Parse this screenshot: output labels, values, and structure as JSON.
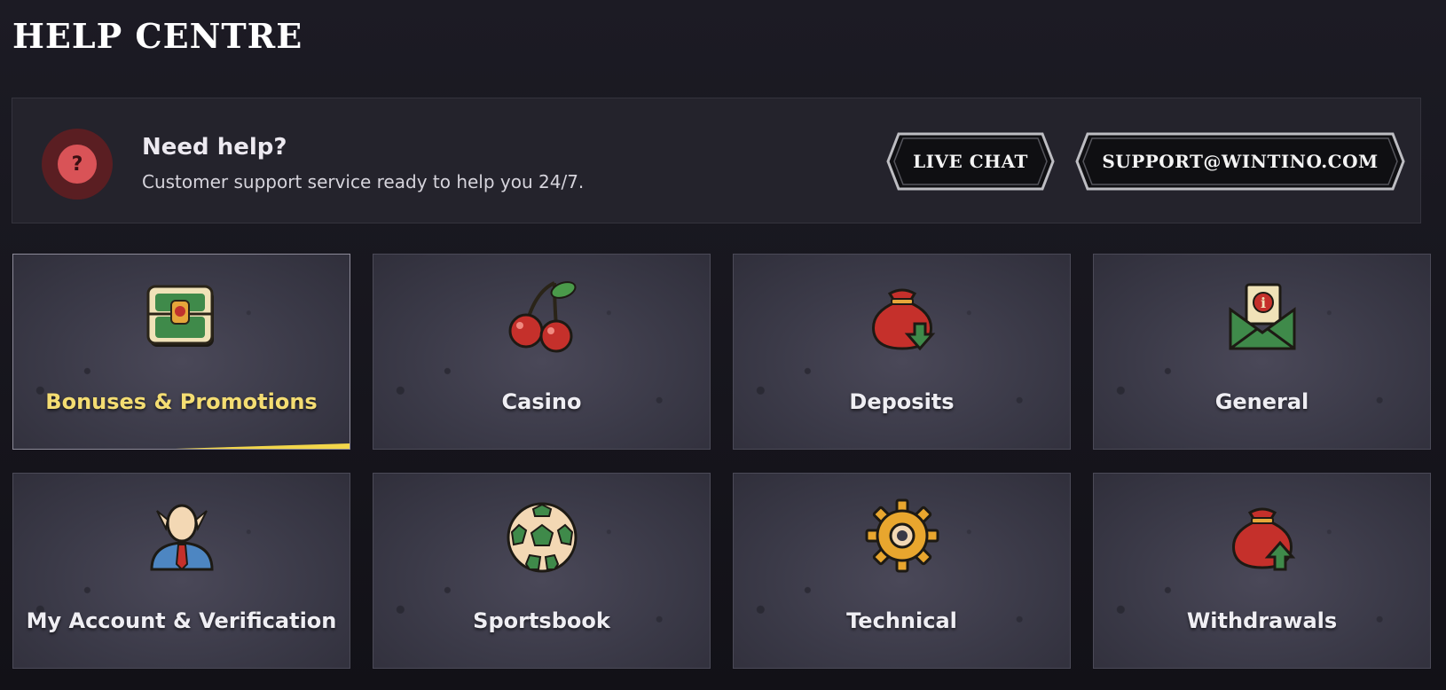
{
  "header": {
    "title": "HELP CENTRE"
  },
  "help": {
    "icon_glyph": "?",
    "heading": "Need help?",
    "text": "Customer support service ready to help you 24/7.",
    "live_chat_label": "LIVE CHAT",
    "email_label": "SUPPORT@WINTINO.COM"
  },
  "categories": [
    {
      "label": "Bonuses & Promotions",
      "icon": "treasure-chest-icon",
      "active": true
    },
    {
      "label": "Casino",
      "icon": "cherries-icon"
    },
    {
      "label": "Deposits",
      "icon": "money-bag-down-icon"
    },
    {
      "label": "General",
      "icon": "info-envelope-icon"
    },
    {
      "label": "My Account & Verification",
      "icon": "user-avatar-icon"
    },
    {
      "label": "Sportsbook",
      "icon": "soccer-ball-icon"
    },
    {
      "label": "Technical",
      "icon": "gear-icon"
    },
    {
      "label": "Withdrawals",
      "icon": "money-bag-up-icon"
    }
  ],
  "colors": {
    "active_label": "#f4dd72",
    "active_bar": "#f2d64a",
    "help_icon": "#d95357"
  }
}
